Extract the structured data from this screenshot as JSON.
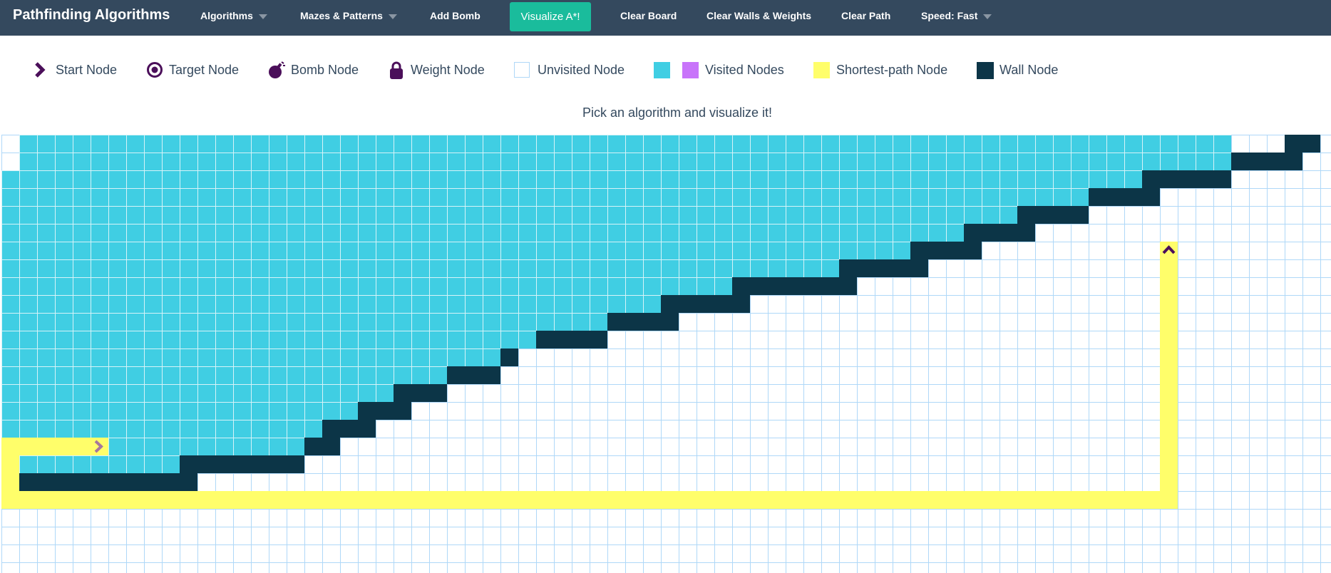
{
  "navbar": {
    "brand": "Pathfinding Algorithms",
    "algorithms": "Algorithms",
    "mazes": "Mazes & Patterns",
    "add_bomb": "Add Bomb",
    "visualize": "Visualize A*!",
    "clear_board": "Clear Board",
    "clear_walls": "Clear Walls & Weights",
    "clear_path": "Clear Path",
    "speed": "Speed: Fast"
  },
  "legend": {
    "start": "Start Node",
    "target": "Target Node",
    "bomb": "Bomb Node",
    "weight": "Weight Node",
    "unvisited": "Unvisited Node",
    "visited": "Visited Nodes",
    "shortest": "Shortest-path Node",
    "wall": "Wall Node"
  },
  "instruction": "Pick an algorithm and visualize it!",
  "colors": {
    "navbar": "#34495e",
    "visualize_button": "#1abc9c",
    "visited_primary": "#40cee3",
    "visited_secondary": "#c874fa",
    "shortest_path": "#fffe6a",
    "wall": "#0c3547",
    "grid_line": "#afd8f8",
    "node_icon": "#4b0f5a"
  },
  "board": {
    "rows": 25,
    "cols": 75,
    "start_node": [
      17,
      5
    ],
    "target_node": [
      6,
      65
    ],
    "visited_rows": [
      [
        [
          1,
          68
        ]
      ],
      [
        [
          1,
          68
        ]
      ],
      [
        [
          0,
          63
        ]
      ],
      [
        [
          0,
          60
        ]
      ],
      [
        [
          0,
          56
        ]
      ],
      [
        [
          0,
          53
        ]
      ],
      [
        [
          0,
          50
        ]
      ],
      [
        [
          0,
          47
        ]
      ],
      [
        [
          0,
          43
        ]
      ],
      [
        [
          0,
          37
        ]
      ],
      [
        [
          0,
          34
        ]
      ],
      [
        [
          0,
          30
        ]
      ],
      [
        [
          0,
          28
        ]
      ],
      [
        [
          0,
          25
        ]
      ],
      [
        [
          0,
          22
        ]
      ],
      [
        [
          0,
          19
        ]
      ],
      [
        [
          0,
          17
        ]
      ],
      [
        [
          0,
          16
        ]
      ],
      [
        [
          0,
          9
        ]
      ]
    ],
    "wall_rows": [
      [
        [
          72,
          73
        ]
      ],
      [
        [
          69,
          72
        ]
      ],
      [
        [
          64,
          68
        ]
      ],
      [
        [
          61,
          64
        ]
      ],
      [
        [
          57,
          60
        ]
      ],
      [
        [
          54,
          57
        ]
      ],
      [
        [
          51,
          54
        ]
      ],
      [
        [
          47,
          51
        ]
      ],
      [
        [
          41,
          47
        ]
      ],
      [
        [
          37,
          41
        ]
      ],
      [
        [
          34,
          37
        ]
      ],
      [
        [
          30,
          33
        ]
      ],
      [
        [
          28,
          28
        ]
      ],
      [
        [
          25,
          27
        ]
      ],
      [
        [
          22,
          24
        ]
      ],
      [
        [
          20,
          22
        ]
      ],
      [
        [
          18,
          20
        ]
      ],
      [
        [
          17,
          18
        ]
      ],
      [
        [
          10,
          16
        ]
      ],
      [
        [
          1,
          10
        ]
      ]
    ],
    "shortest_path": [
      [
        17,
        0
      ],
      [
        17,
        1
      ],
      [
        17,
        2
      ],
      [
        17,
        3
      ],
      [
        17,
        4
      ],
      [
        17,
        5
      ],
      [
        18,
        0
      ],
      [
        19,
        0
      ],
      [
        20,
        0
      ],
      [
        20,
        1
      ],
      [
        20,
        2
      ],
      [
        20,
        3
      ],
      [
        20,
        4
      ],
      [
        20,
        5
      ],
      [
        20,
        6
      ],
      [
        20,
        7
      ],
      [
        20,
        8
      ],
      [
        20,
        9
      ],
      [
        20,
        10
      ],
      [
        20,
        11
      ],
      [
        20,
        12
      ],
      [
        20,
        13
      ],
      [
        20,
        14
      ],
      [
        20,
        15
      ],
      [
        20,
        16
      ],
      [
        20,
        17
      ],
      [
        20,
        18
      ],
      [
        20,
        19
      ],
      [
        20,
        20
      ],
      [
        20,
        21
      ],
      [
        20,
        22
      ],
      [
        20,
        23
      ],
      [
        20,
        24
      ],
      [
        20,
        25
      ],
      [
        20,
        26
      ],
      [
        20,
        27
      ],
      [
        20,
        28
      ],
      [
        20,
        29
      ],
      [
        20,
        30
      ],
      [
        20,
        31
      ],
      [
        20,
        32
      ],
      [
        20,
        33
      ],
      [
        20,
        34
      ],
      [
        20,
        35
      ],
      [
        20,
        36
      ],
      [
        20,
        37
      ],
      [
        20,
        38
      ],
      [
        20,
        39
      ],
      [
        20,
        40
      ],
      [
        20,
        41
      ],
      [
        20,
        42
      ],
      [
        20,
        43
      ],
      [
        20,
        44
      ],
      [
        20,
        45
      ],
      [
        20,
        46
      ],
      [
        20,
        47
      ],
      [
        20,
        48
      ],
      [
        20,
        49
      ],
      [
        20,
        50
      ],
      [
        20,
        51
      ],
      [
        20,
        52
      ],
      [
        20,
        53
      ],
      [
        20,
        54
      ],
      [
        20,
        55
      ],
      [
        20,
        56
      ],
      [
        20,
        57
      ],
      [
        20,
        58
      ],
      [
        20,
        59
      ],
      [
        20,
        60
      ],
      [
        20,
        61
      ],
      [
        20,
        62
      ],
      [
        20,
        63
      ],
      [
        20,
        64
      ],
      [
        20,
        65
      ],
      [
        19,
        65
      ],
      [
        18,
        65
      ],
      [
        17,
        65
      ],
      [
        16,
        65
      ],
      [
        15,
        65
      ],
      [
        14,
        65
      ],
      [
        13,
        65
      ],
      [
        12,
        65
      ],
      [
        11,
        65
      ],
      [
        10,
        65
      ],
      [
        9,
        65
      ],
      [
        8,
        65
      ],
      [
        7,
        65
      ],
      [
        6,
        65
      ]
    ]
  }
}
